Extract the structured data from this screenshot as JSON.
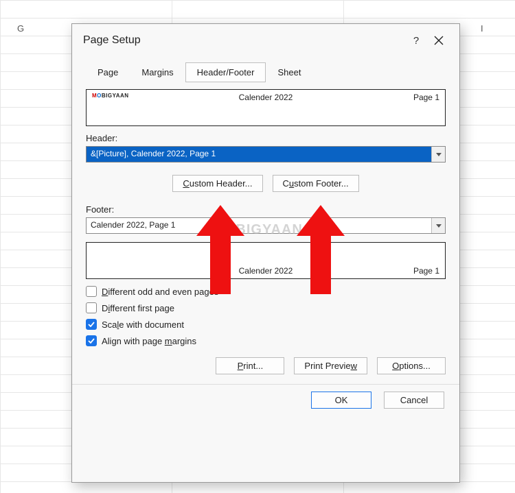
{
  "columns": {
    "g": "G",
    "i": "I"
  },
  "dialog": {
    "title": "Page Setup",
    "help": "?",
    "tabs": {
      "page": "Page",
      "margins": "Margins",
      "header_footer": "Header/Footer",
      "sheet": "Sheet"
    }
  },
  "preview": {
    "logo_a": "M",
    "logo_b": "O",
    "logo_rest": "BIGYAAN",
    "center": "Calender 2022",
    "right": "Page 1"
  },
  "header_label": "Header:",
  "header_value": "&[Picture], Calender 2022, Page 1",
  "custom_header": "Custom Header...",
  "custom_footer": "Custom Footer...",
  "footer_label": "Footer:",
  "footer_value": "Calender 2022, Page 1",
  "checks": {
    "odd_even": "Different odd and even pages",
    "first_page": "Different first page",
    "scale": "Scale with document",
    "align": "Align with page margins"
  },
  "actions": {
    "print": "Print...",
    "preview": "Print Preview",
    "options": "Options..."
  },
  "bottom": {
    "ok": "OK",
    "cancel": "Cancel"
  },
  "watermark": "MOBIGYAAN"
}
